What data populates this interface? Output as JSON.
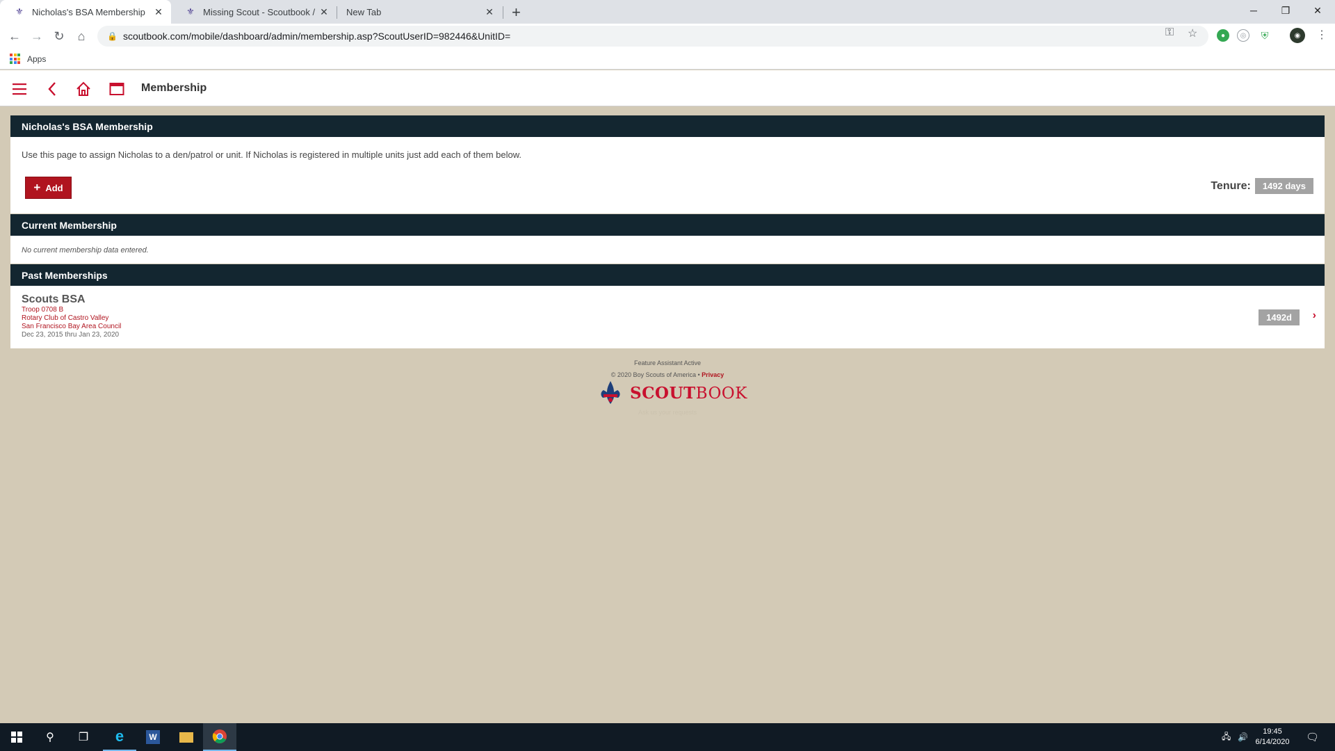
{
  "browser": {
    "tabs": [
      {
        "title": "Nicholas's BSA Membership",
        "active": true
      },
      {
        "title": "Missing Scout - Scoutbook / Sco",
        "active": false
      },
      {
        "title": "New Tab",
        "active": false
      }
    ],
    "url": "scoutbook.com/mobile/dashboard/admin/membership.asp?ScoutUserID=982446&UnitID=",
    "bookmarks": {
      "apps_label": "Apps"
    }
  },
  "app_header": {
    "title": "Membership"
  },
  "membership_panel": {
    "title": "Nicholas's BSA Membership",
    "intro": "Use this page to assign Nicholas to a den/patrol or unit. If Nicholas is registered in multiple units just add each of them below.",
    "add_label": "Add",
    "tenure_label": "Tenure:",
    "tenure_value": "1492 days"
  },
  "current_panel": {
    "title": "Current Membership",
    "empty_text": "No current membership data entered."
  },
  "past_panel": {
    "title": "Past Memberships",
    "items": [
      {
        "type": "Scouts BSA",
        "unit": "Troop 0708 B",
        "org": "Rotary Club of Castro Valley",
        "council": "San Francisco Bay Area Council",
        "dates": "Dec 23, 2015 thru Jan 23, 2020",
        "badge": "1492d"
      }
    ]
  },
  "footer": {
    "feature_text": "Feature Assistant Active",
    "copyright": "© 2020 Boy Scouts of America • ",
    "privacy": "Privacy",
    "logo_scout": "SCOUT",
    "logo_book": "BOOK",
    "tagline": "Ask us your requests"
  },
  "taskbar": {
    "time": "19:45",
    "date": "6/14/2020"
  },
  "colors": {
    "brand_red": "#c8102e",
    "panel_header": "#132630",
    "page_bg": "#d3cab6",
    "badge_gray": "#a3a3a3"
  }
}
